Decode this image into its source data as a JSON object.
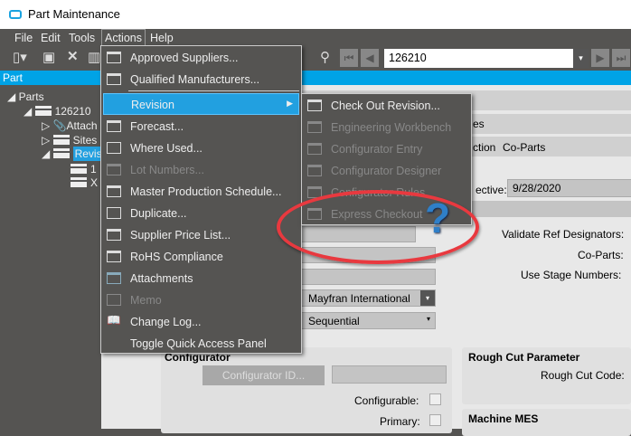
{
  "window": {
    "title": "Part Maintenance"
  },
  "menubar": [
    "File",
    "Edit",
    "Tools",
    "Actions",
    "Help"
  ],
  "toolbar": {
    "record": "126210"
  },
  "part_bar": "Part",
  "tree": {
    "root": "Parts",
    "part": "126210",
    "children": [
      "Attach",
      "Sites (",
      "Revisi"
    ],
    "revisions": [
      "1",
      "X"
    ]
  },
  "actions_menu": [
    {
      "label": "Approved Suppliers...",
      "enabled": true
    },
    {
      "label": "Qualified Manufacturers...",
      "enabled": true
    },
    {
      "label": "Revision",
      "enabled": true,
      "submenu": true
    },
    {
      "label": "Forecast...",
      "enabled": true
    },
    {
      "label": "Where Used...",
      "enabled": true
    },
    {
      "label": "Lot Numbers...",
      "enabled": false
    },
    {
      "label": "Master Production Schedule...",
      "enabled": true
    },
    {
      "label": "Duplicate...",
      "enabled": true
    },
    {
      "label": "Supplier Price List...",
      "enabled": true
    },
    {
      "label": "RoHS Compliance",
      "enabled": true
    },
    {
      "label": "Attachments",
      "enabled": true
    },
    {
      "label": "Memo",
      "enabled": false
    },
    {
      "label": "Change Log...",
      "enabled": true
    },
    {
      "label": "Toggle Quick Access Panel",
      "enabled": true
    }
  ],
  "revision_submenu": [
    {
      "label": "Check Out Revision...",
      "enabled": true
    },
    {
      "label": "Engineering Workbench",
      "enabled": false
    },
    {
      "label": "Configurator Entry",
      "enabled": false
    },
    {
      "label": "Configurator Designer",
      "enabled": false
    },
    {
      "label": "Configurator Rules",
      "enabled": false
    },
    {
      "label": "Express Checkout",
      "enabled": false
    }
  ],
  "content": {
    "tab_partial": "es",
    "tab_partial2": "ction",
    "tab_coparts": "Co-Parts",
    "effective_label": "ective:",
    "effective_value": "9/28/2020",
    "validate_label": "Validate Ref Designators:",
    "coparts_label": "Co-Parts:",
    "stage_label": "Use Stage Numbers:",
    "site_value": "Mayfran International",
    "sequence_value": "Sequential",
    "configurator_title": "Configurator",
    "configurator_btn": "Configurator ID...",
    "configurable_label": "Configurable:",
    "primary_label": "Primary:",
    "rough_title": "Rough Cut Parameter",
    "rough_label": "Rough Cut Code:",
    "mes_title": "Machine MES"
  },
  "colors": {
    "accent": "#00a3e6",
    "annotation": "#e8393f",
    "question": "#2f7fc8"
  }
}
